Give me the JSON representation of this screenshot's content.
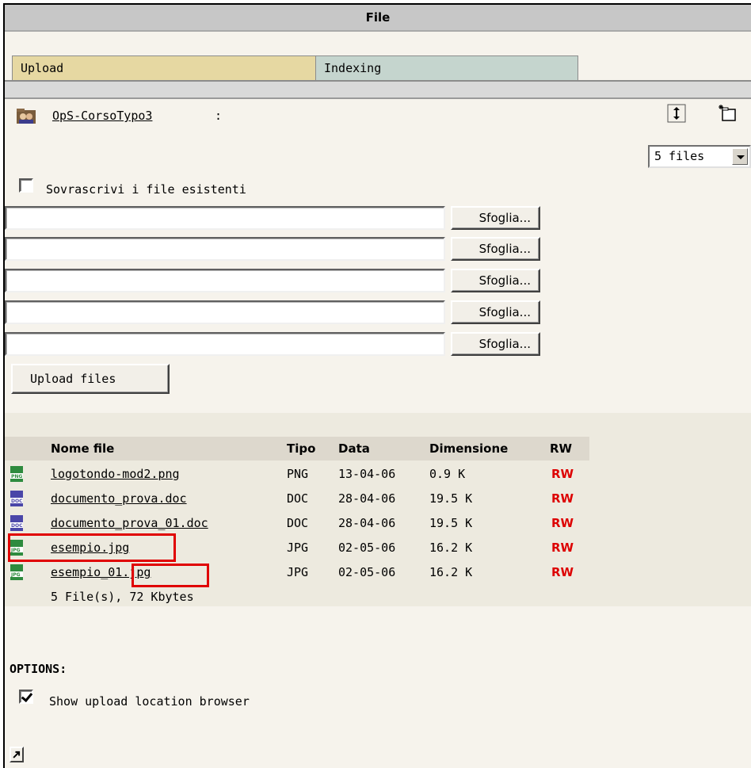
{
  "header": {
    "title": "File"
  },
  "tabs": [
    {
      "label": "Upload",
      "active": true
    },
    {
      "label": "Indexing",
      "active": false
    }
  ],
  "path": {
    "folder": "OpS-CorsoTypo3",
    "separator": ":"
  },
  "toolbar": {
    "reload_icon": "reload-icon",
    "new_icon": "new-folder-icon"
  },
  "files_select": {
    "selected": "5 files"
  },
  "upload": {
    "overwrite_label": "Sovrascrivi i file esistenti",
    "overwrite_checked": false,
    "browse_label": "Sfoglia...",
    "inputs": [
      "",
      "",
      "",
      "",
      ""
    ],
    "submit_label": "Upload files"
  },
  "list": {
    "columns": [
      "Nome file",
      "Tipo",
      "Data",
      "Dimensione",
      "RW"
    ],
    "rows": [
      {
        "icon": "png-icon",
        "name": "logotondo-mod2.png",
        "type": "PNG",
        "date": "13-04-06",
        "size": "0.9 K",
        "rw": "RW"
      },
      {
        "icon": "doc-icon",
        "name": "documento_prova.doc",
        "type": "DOC",
        "date": "28-04-06",
        "size": "19.5 K",
        "rw": "RW"
      },
      {
        "icon": "doc-icon",
        "name": "documento_prova_01.doc",
        "type": "DOC",
        "date": "28-04-06",
        "size": "19.5 K",
        "rw": "RW"
      },
      {
        "icon": "jpg-icon",
        "name": "esempio.jpg",
        "type": "JPG",
        "date": "02-05-06",
        "size": "16.2 K",
        "rw": "RW"
      },
      {
        "icon": "jpg-icon",
        "name": "esempio_01.jpg",
        "type": "JPG",
        "date": "02-05-06",
        "size": "16.2 K",
        "rw": "RW"
      }
    ],
    "summary": "5 File(s), 72 Kbytes"
  },
  "options": {
    "title": "OPTIONS:",
    "show_upload_label": "Show upload location browser",
    "show_upload_checked": true
  },
  "colors": {
    "upload_tab": "#e6d8a2",
    "indexing_tab": "#c5d5ce",
    "rw": "#dd0000",
    "highlight": "#e00000"
  }
}
